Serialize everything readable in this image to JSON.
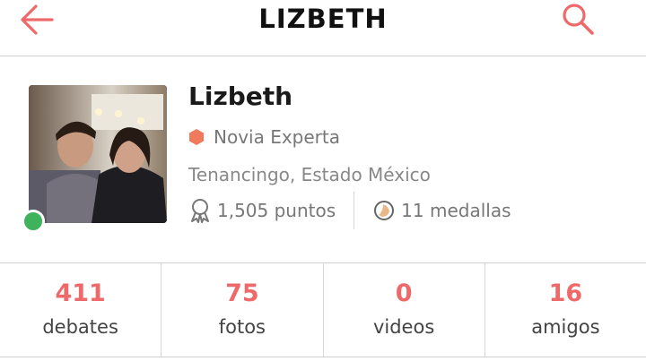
{
  "header": {
    "title": "LIZBETH",
    "back_icon": "arrow-left-icon",
    "search_icon": "search-icon"
  },
  "profile": {
    "name": "Lizbeth",
    "rank": "Novia Experta",
    "location": "Tenancingo, Estado México",
    "points": "1,505 puntos",
    "medals": "11 medallas",
    "online": true
  },
  "counters": [
    {
      "value": "411",
      "label": "debates"
    },
    {
      "value": "75",
      "label": "fotos"
    },
    {
      "value": "0",
      "label": "videos"
    },
    {
      "value": "16",
      "label": "amigos"
    }
  ],
  "colors": {
    "accent": "#ee6a6a",
    "online": "#3fb35c",
    "rank_badge": "#f07b5c"
  }
}
